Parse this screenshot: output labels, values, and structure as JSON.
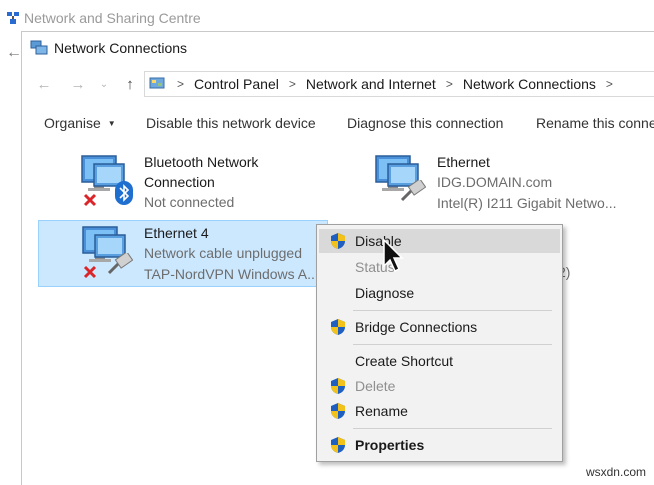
{
  "background_window": {
    "title": "Network and Sharing Centre"
  },
  "window": {
    "title": "Network Connections"
  },
  "address_bar": {
    "breadcrumbs": [
      "Control Panel",
      "Network and Internet",
      "Network Connections"
    ]
  },
  "toolbar": {
    "organise": "Organise",
    "disable": "Disable this network device",
    "diagnose": "Diagnose this connection",
    "rename": "Rename this conne"
  },
  "connections": [
    {
      "name_line1": "Bluetooth Network",
      "name_line2": "Connection",
      "status": "Not connected",
      "device": ""
    },
    {
      "name_line1": "Ethernet",
      "name_line2": "",
      "status": "IDG.DOMAIN.com",
      "device": "Intel(R) I211 Gigabit Netwo..."
    },
    {
      "name_line1": "Ethernet 4",
      "name_line2": "",
      "status": "Network cable unplugged",
      "device": "TAP-NordVPN Windows A..."
    }
  ],
  "hidden_partial_text": "2)",
  "context_menu": {
    "items": [
      {
        "label": "Disable",
        "shield": true,
        "state": "hover"
      },
      {
        "label": "Status",
        "shield": false,
        "state": "disabled"
      },
      {
        "label": "Diagnose",
        "shield": false,
        "state": "normal"
      },
      {
        "label": "Bridge Connections",
        "shield": true,
        "state": "normal"
      },
      {
        "label": "Create Shortcut",
        "shield": false,
        "state": "normal"
      },
      {
        "label": "Delete",
        "shield": true,
        "state": "disabled"
      },
      {
        "label": "Rename",
        "shield": true,
        "state": "normal"
      },
      {
        "label": "Properties",
        "shield": true,
        "state": "bold"
      }
    ]
  },
  "watermark": "wsxdn.com"
}
